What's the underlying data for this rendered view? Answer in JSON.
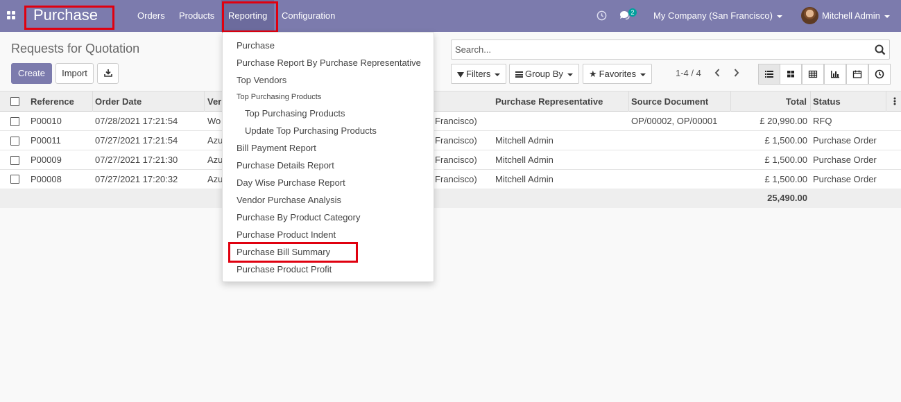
{
  "navbar": {
    "app_name": "Purchase",
    "menus": [
      "Orders",
      "Products",
      "Reporting",
      "Configuration"
    ],
    "messages_count": "2",
    "company": "My Company (San Francisco)",
    "user": "Mitchell Admin",
    "bg_color": "#7c7bad",
    "active_color": "#6c6b9d"
  },
  "control_panel": {
    "title": "Requests for Quotation",
    "create_label": "Create",
    "import_label": "Import",
    "search_placeholder": "Search...",
    "filters_label": "Filters",
    "group_by_label": "Group By",
    "favorites_label": "Favorites",
    "pager": "1-4 / 4"
  },
  "table": {
    "columns": [
      "Reference",
      "Order Date",
      "Ver",
      "Purchase Representative",
      "Source Document",
      "Total",
      "Status"
    ],
    "rows": [
      {
        "reference": "P00010",
        "date": "07/28/2021 17:21:54",
        "vendor": "Wo",
        "company_tail": "Francisco)",
        "rep": "",
        "source": "OP/00002, OP/00001",
        "total": "£ 20,990.00",
        "status": "RFQ"
      },
      {
        "reference": "P00011",
        "date": "07/27/2021 17:21:54",
        "vendor": "Azu",
        "company_tail": "Francisco)",
        "rep": "Mitchell Admin",
        "source": "",
        "total": "£ 1,500.00",
        "status": "Purchase Order"
      },
      {
        "reference": "P00009",
        "date": "07/27/2021 17:21:30",
        "vendor": "Azu",
        "company_tail": "Francisco)",
        "rep": "Mitchell Admin",
        "source": "",
        "total": "£ 1,500.00",
        "status": "Purchase Order"
      },
      {
        "reference": "P00008",
        "date": "07/27/2021 17:20:32",
        "vendor": "Azu",
        "company_tail": "Francisco)",
        "rep": "Mitchell Admin",
        "source": "",
        "total": "£ 1,500.00",
        "status": "Purchase Order"
      }
    ],
    "footer_total": "25,490.00"
  },
  "reporting_menu": {
    "items": [
      "Purchase",
      "Purchase Report By Purchase Representative",
      "Top Vendors"
    ],
    "section_header": "Top Purchasing Products",
    "sub_items": [
      "Top Purchasing Products",
      "Update Top Purchasing Products"
    ],
    "more_items": [
      "Bill Payment Report",
      "Purchase Details Report",
      "Day Wise Purchase Report",
      "Vendor Purchase Analysis",
      "Purchase By Product Category",
      "Purchase Product Indent",
      "Purchase Bill Summary",
      "Purchase Product Profit"
    ]
  },
  "highlight_color": "#e0000f"
}
